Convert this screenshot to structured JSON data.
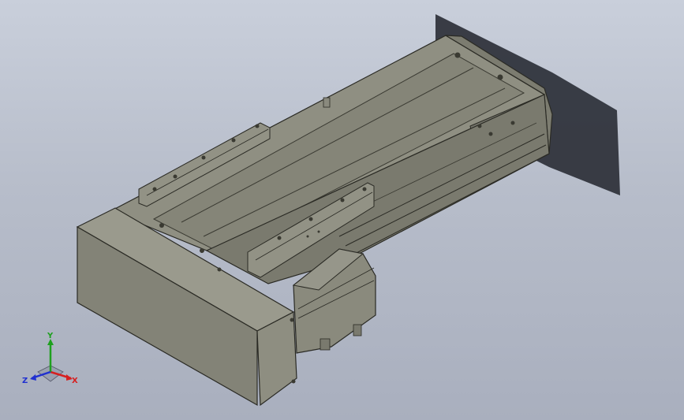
{
  "viewport": {
    "background_top": "#c9cfdb",
    "background_bottom": "#a9afbe"
  },
  "model": {
    "body_color": "#8d8d80",
    "edge_color": "#2a2a24",
    "shadow_color": "#2c3038"
  },
  "triad": {
    "x_label": "X",
    "y_label": "Y",
    "z_label": "Z",
    "x_color": "#d62020",
    "y_color": "#1ea01e",
    "z_color": "#2030d0"
  }
}
